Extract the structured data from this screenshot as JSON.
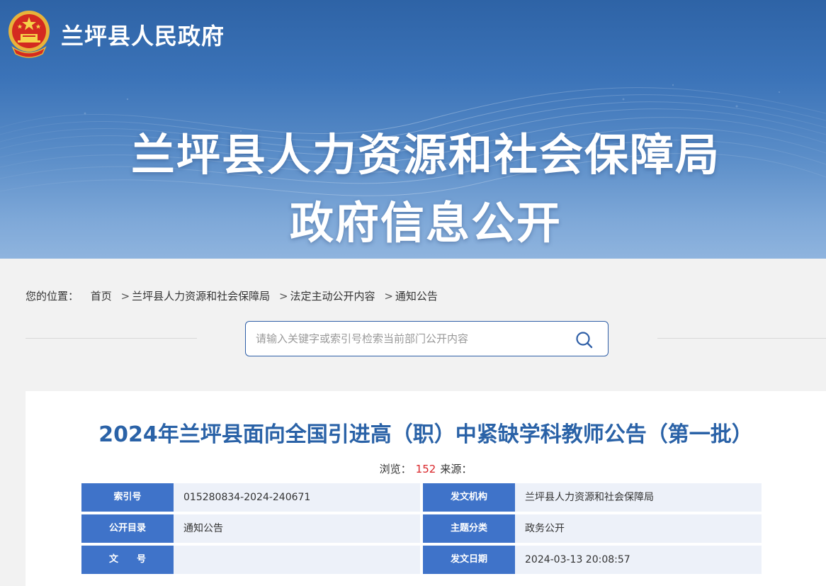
{
  "header": {
    "gov_name": "兰坪县人民政府",
    "title_line1": "兰坪县人力资源和社会保障局",
    "title_line2": "政府信息公开",
    "emblem_icon": "national-emblem-icon"
  },
  "breadcrumb": {
    "label": "您的位置：",
    "items": [
      "首页",
      "兰坪县人力资源和社会保障局",
      "法定主动公开内容",
      "通知公告"
    ],
    "separator": ">"
  },
  "search": {
    "placeholder": "请输入关键字或索引号检索当前部门公开内容",
    "value": "",
    "icon": "search-icon"
  },
  "article": {
    "title": "2024年兰坪县面向全国引进高（职）中紧缺学科教师公告（第一批）",
    "views_label": "浏览：",
    "views": "152",
    "source_label": "来源："
  },
  "info": {
    "index_no_label": "索引号",
    "index_no": "015280834-2024-240671",
    "issuer_label": "发文机构",
    "issuer": "兰坪县人力资源和社会保障局",
    "catalog_label": "公开目录",
    "catalog": "通知公告",
    "topic_label": "主题分类",
    "topic": "政务公开",
    "doc_no_label": "文　　号",
    "doc_no": "",
    "date_label": "发文日期",
    "date": "2024-03-13 20:08:57"
  },
  "colors": {
    "banner_top": "#2e63a6",
    "banner_bottom": "#8fb4de",
    "title_blue": "#2a62a7",
    "label_blue": "#3f73c9",
    "value_bg": "#edf1f9",
    "views_red": "#d9262a"
  }
}
